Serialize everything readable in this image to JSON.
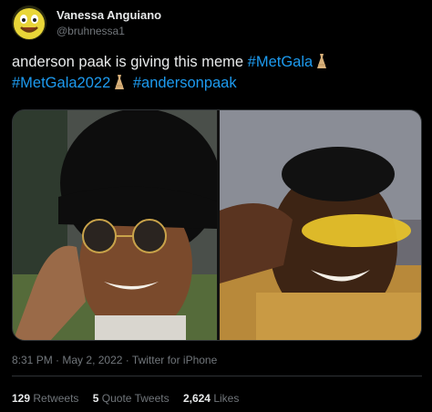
{
  "author": {
    "name": "Vanessa Anguiano",
    "handle": "@bruhnessa1",
    "avatar_icon": "smiling-emoji-avatar"
  },
  "tweet": {
    "text_intro": "anderson paak is giving this meme",
    "hashtags": [
      "#MetGala",
      "#MetGala2022",
      "#andersonpaak"
    ],
    "inline_icon": "dress-emoji"
  },
  "media": {
    "photos": [
      {
        "description_icon": "anderson-paak-photo"
      },
      {
        "description_icon": "meme-photo"
      }
    ]
  },
  "meta": {
    "time": "8:31 PM",
    "date": "May 2, 2022",
    "source": "Twitter for iPhone",
    "separator": "·"
  },
  "stats": {
    "retweets_count": "129",
    "retweets_label": "Retweets",
    "quotes_count": "5",
    "quotes_label": "Quote Tweets",
    "likes_count": "2,624",
    "likes_label": "Likes"
  },
  "colors": {
    "background": "#000000",
    "text": "#e7e9ea",
    "secondary": "#71767b",
    "link": "#1d9bf0",
    "divider": "#2f3336"
  }
}
